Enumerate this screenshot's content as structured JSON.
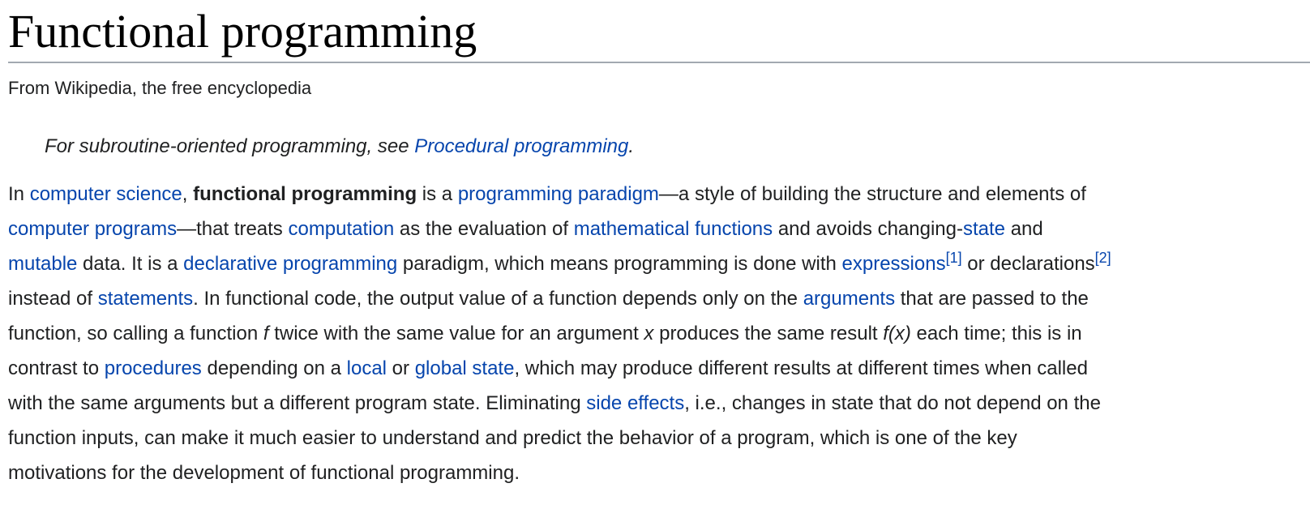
{
  "article": {
    "title": "Functional programming",
    "site_sub": "From Wikipedia, the free encyclopedia",
    "hatnote": {
      "prefix": "For subroutine-oriented programming, see ",
      "link": "Procedural programming",
      "suffix": "."
    },
    "lead": {
      "t1": "In ",
      "l_cs": "computer science",
      "t2": ", ",
      "b_fp": "functional programming",
      "t3": " is a ",
      "l_pp": "programming paradigm",
      "t4": "—a style of building the structure and elements of",
      "l_cp": "computer programs",
      "t5": "—that treats ",
      "l_comp": "computation",
      "t6": " as the evaluation of ",
      "l_mf": "mathematical functions",
      "t7": " and avoids changing-",
      "l_state": "state",
      "t8": " and",
      "l_mut": "mutable",
      "t9": " data. It is a ",
      "l_dp": "declarative programming",
      "t10": " paradigm, which means programming is done with ",
      "l_expr": "expressions",
      "ref1": "[1]",
      "t11": " or declarations",
      "ref2": "[2]",
      "t12": "instead of ",
      "l_stmt": "statements",
      "t13": ". In functional code, the output value of a function depends only on the ",
      "l_args": "arguments",
      "t14": " that are passed to the",
      "t15": "function, so calling a function ",
      "i_f": "f",
      "t16": " twice with the same value for an argument ",
      "i_x": "x",
      "t17": " produces the same result ",
      "i_fx": "f(x)",
      "t18": " each time; this is in",
      "t19": "contrast to ",
      "l_proc": "procedures",
      "t20": " depending on a ",
      "l_local": "local",
      "t21": " or ",
      "l_global": "global state",
      "t22": ", which may produce different results at different times when called",
      "t23": "with the same arguments but a different program state. Eliminating ",
      "l_side": "side effects",
      "t24": ", i.e., changes in state that do not depend on the",
      "t25": "function inputs, can make it much easier to understand and predict the behavior of a program, which is one of the key",
      "t26": "motivations for the development of functional programming."
    }
  }
}
